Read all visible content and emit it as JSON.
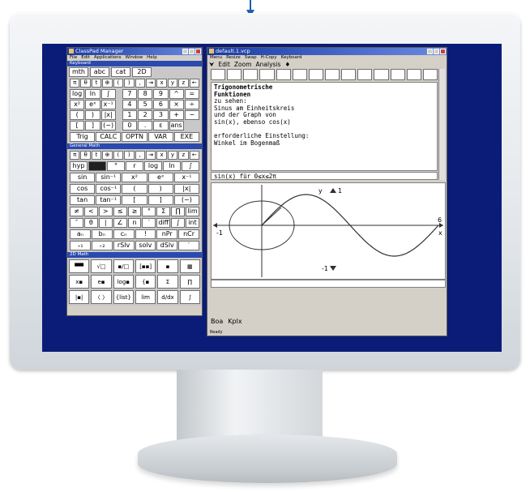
{
  "colors": {
    "screen_bg": "#0b1c78",
    "titlebar": "#1a3aa0",
    "panel_header": "#2a4ab0",
    "window_bg": "#d4d0c8",
    "curve": "#303030",
    "arrow": "#1e5fb0"
  },
  "manager": {
    "title": "ClassPad Manager",
    "menu": [
      "File",
      "Edit",
      "Applications",
      "Window",
      "Help"
    ],
    "keyboard": {
      "label": "Keyboard",
      "tabs": [
        "mth",
        "abc",
        "cat",
        "2D"
      ],
      "rows": [
        [
          "π",
          "θ",
          "t",
          "⊕",
          "(",
          ")",
          ",",
          "⇥",
          "x",
          "y",
          "z",
          "←"
        ],
        [
          "log",
          "ln",
          "∫",
          "7",
          "8",
          "9",
          "^",
          "="
        ],
        [
          "x²",
          "eˣ",
          "x⁻¹",
          "4",
          "5",
          "6",
          "×",
          "÷"
        ],
        [
          "(",
          ")",
          "|x|",
          "1",
          "2",
          "3",
          "+",
          "−"
        ],
        [
          "[",
          "]",
          "(−)",
          "0",
          ".",
          "ε",
          "ans"
        ]
      ],
      "bottom": [
        "Trig",
        "CALC",
        "OPTN",
        "VAR",
        "EXE"
      ]
    },
    "general_math": {
      "label": "General Math",
      "top": [
        "π",
        "θ",
        "t",
        "⊕",
        "(",
        ")",
        ",",
        "⇥",
        "x",
        "y",
        "z",
        "←"
      ],
      "rows": [
        [
          "hyp",
          "",
          "°",
          "r",
          "log",
          "ln",
          "∫"
        ],
        [
          "sin",
          "sin⁻¹",
          "x²",
          "eˣ",
          "x⁻¹"
        ],
        [
          "cos",
          "cos⁻¹",
          "(",
          ")",
          "|x|"
        ],
        [
          "tan",
          "tan⁻¹",
          "[",
          "]",
          "(−)"
        ],
        [
          "≠",
          "<",
          ">",
          "≤",
          "≥",
          "°",
          "Σ",
          "∏",
          "lim"
        ],
        [
          "″",
          "θ",
          "|",
          "∠",
          "n",
          "′",
          "diff",
          "∫",
          "int"
        ],
        [
          "aₙ",
          "bₙ",
          "cₙ",
          "!",
          "nPr",
          "nCr"
        ],
        [
          "₊₁",
          "₊₂",
          "rSlv",
          "solv",
          "dSlv",
          "′"
        ]
      ]
    },
    "math_2d": {
      "label": "2D Math",
      "icons": [
        "matrix-icon",
        "sqrt-icon",
        "fraction-icon",
        "bracket-icon",
        "column-icon",
        "grid-icon",
        "power-icon",
        "exp-icon",
        "log-base-icon",
        "piecewise-icon",
        "sum-icon",
        "product-icon",
        "abs-icon",
        "brace-icon",
        "list-icon",
        "limit-icon",
        "derivative-icon",
        "integral-icon"
      ],
      "labels": [
        "▀▀",
        "√□",
        "▪/□",
        "[▪▪]",
        "▪",
        "▦",
        "x▪",
        "e▪",
        "log▪",
        "{▪",
        "Σ",
        "∏",
        "|▪|",
        "〈 〉",
        "{list}",
        "lim",
        "d/dx",
        "∫"
      ]
    }
  },
  "doc": {
    "title": "default.1.vcp",
    "menu": [
      "Menu",
      "Resize",
      "Swap",
      "H-Copy",
      "Keyboard"
    ],
    "toolbar": [
      "Edit",
      "Zoom",
      "Analysis",
      "♦"
    ],
    "lines": [
      {
        "text": "Trigonometrische",
        "bold": true
      },
      {
        "text": "Funktionen",
        "bold": true
      },
      {
        "text": "zu sehen:",
        "bold": false
      },
      {
        "text": "Sinus am Einheitskreis",
        "bold": false
      },
      {
        "text": "und der Graph von",
        "bold": false
      },
      {
        "text": "sin(x), ebenso cos(x)",
        "bold": false
      },
      {
        "text": "",
        "bold": false
      },
      {
        "text": "erforderliche Einstellung:",
        "bold": false
      },
      {
        "text": "Winkel im Bogenmaß",
        "bold": false
      }
    ],
    "formula": "sin(x) für 0≤x≤2π",
    "graph": {
      "y_label": "y",
      "x_label": "x",
      "y_top": "1",
      "y_bottom": "-1",
      "x_left": "-1",
      "x_right": "6"
    },
    "bottom_tabs": [
      "Boa",
      "Kplx"
    ],
    "status": "Ready"
  }
}
